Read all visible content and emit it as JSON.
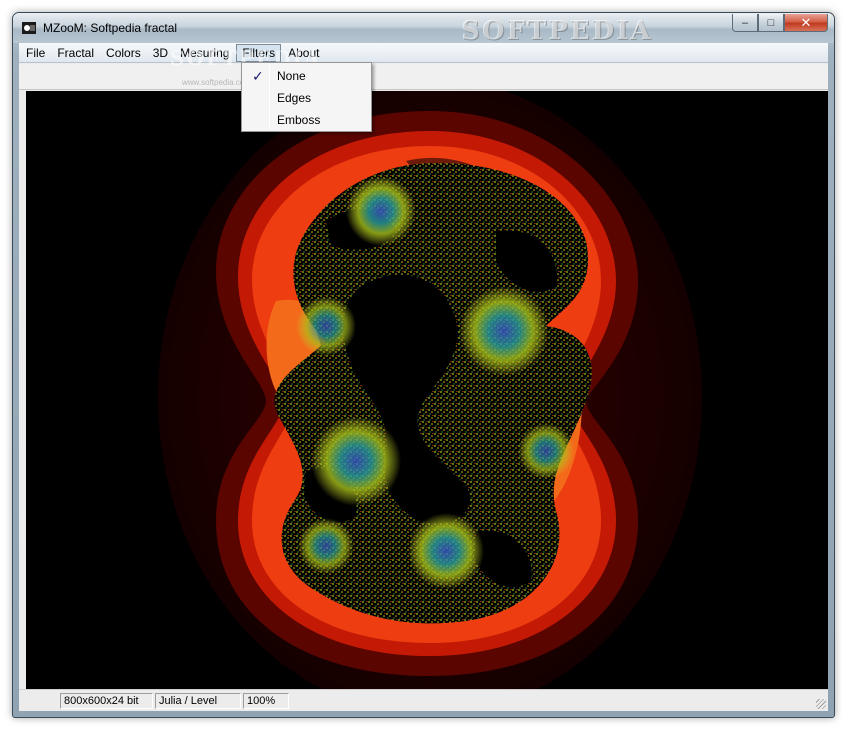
{
  "window": {
    "title": "MZooM: Softpedia fractal",
    "watermark": "SOFTPEDIA",
    "watermark_url": "www.softpedia.com",
    "controls": {
      "minimize": "–",
      "maximize": "□",
      "close": "✕"
    }
  },
  "menubar": {
    "items": [
      "File",
      "Fractal",
      "Colors",
      "3D",
      "Mesuring",
      "Filters",
      "About"
    ],
    "open_menu": "Filters"
  },
  "filters_menu": {
    "items": [
      {
        "label": "None",
        "checked": true
      },
      {
        "label": "Edges",
        "checked": false
      },
      {
        "label": "Emboss",
        "checked": false
      }
    ],
    "check_glyph": "✓"
  },
  "statusbar": {
    "resolution": "800x600x24 bit",
    "fractal_mode": "Julia / Level",
    "zoom": "100%"
  },
  "fractal": {
    "type": "Julia",
    "colors": {
      "background": "#000000",
      "outer_glow": "#1c0000",
      "dark_red": "#5a0500",
      "red": "#c41a05",
      "orange_red": "#ee3d10",
      "orange": "#f36a1a",
      "brown": "#6e1a08",
      "yellow_green": "#a8c21a",
      "blue": "#3a5acf"
    }
  }
}
